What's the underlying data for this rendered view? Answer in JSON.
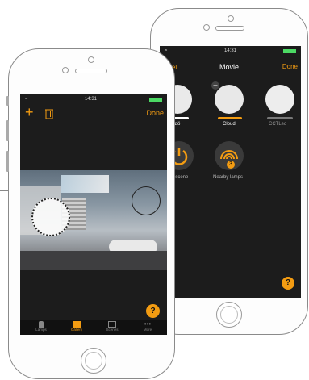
{
  "back_phone": {
    "status_time": "14:31",
    "nav": {
      "cancel": "ancel",
      "title": "Movie",
      "done": "Done"
    },
    "lamps": [
      {
        "name": "Ledö",
        "bar_color": "#ffffff"
      },
      {
        "name": "Cloud",
        "bar_color": "#f39c12"
      },
      {
        "name": "CCTLed",
        "bar_color": "#777777"
      }
    ],
    "actions": [
      {
        "label": "mps in scene",
        "icon": "power-icon"
      },
      {
        "label": "Nearby lamps",
        "icon": "wifi-radar-icon",
        "badge": "3"
      }
    ],
    "help": "?",
    "bottom_left": "s"
  },
  "front_phone": {
    "status_time": "14:31",
    "toolbar": {
      "add": "+",
      "done": "Done"
    },
    "help": "?",
    "tabs": [
      {
        "label": "Lamps",
        "icon": "lamp-icon"
      },
      {
        "label": "Gallery",
        "icon": "gallery-icon"
      },
      {
        "label": "Scenes",
        "icon": "scenes-icon"
      },
      {
        "label": "More",
        "icon": "more-icon"
      }
    ]
  },
  "colors": {
    "accent": "#f39c12",
    "screen_bg": "#1c1c1c"
  }
}
